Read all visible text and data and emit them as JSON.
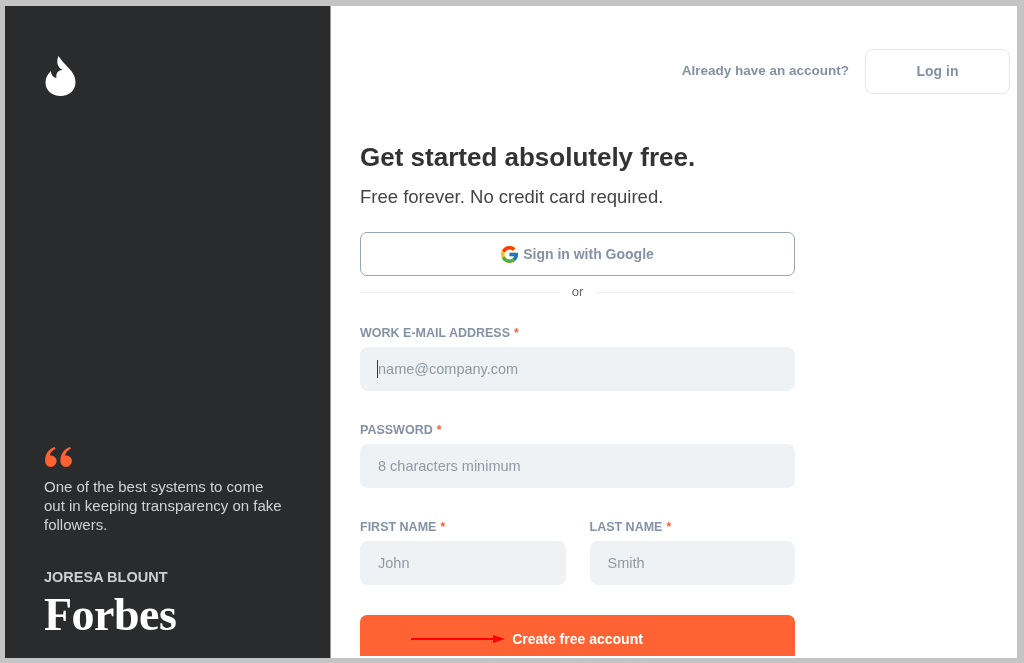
{
  "brand_panel": {
    "quote": "One of the best systems to come out in keeping transparency on fake followers.",
    "author": "JORESA BLOUNT",
    "publication": "Forbes"
  },
  "header": {
    "prompt": "Already have an account?",
    "login_button": "Log in"
  },
  "signup": {
    "title": "Get started absolutely free.",
    "subtitle": "Free forever. No credit card required.",
    "google_button": "Sign in with Google",
    "divider": "or",
    "field_rows": [
      {
        "fields": [
          {
            "label": "WORK E-MAIL ADDRESS",
            "required_mark": "*",
            "placeholder": "name@company.com",
            "focused": true
          }
        ]
      },
      {
        "fields": [
          {
            "label": "PASSWORD",
            "required_mark": "*",
            "placeholder": "8 characters minimum",
            "focused": false
          }
        ]
      },
      {
        "fields": [
          {
            "label": "FIRST NAME",
            "required_mark": "*",
            "placeholder": "John",
            "focused": false
          },
          {
            "label": "LAST NAME",
            "required_mark": "*",
            "placeholder": "Smith",
            "focused": false
          }
        ]
      }
    ],
    "submit_button": "Create free account"
  }
}
